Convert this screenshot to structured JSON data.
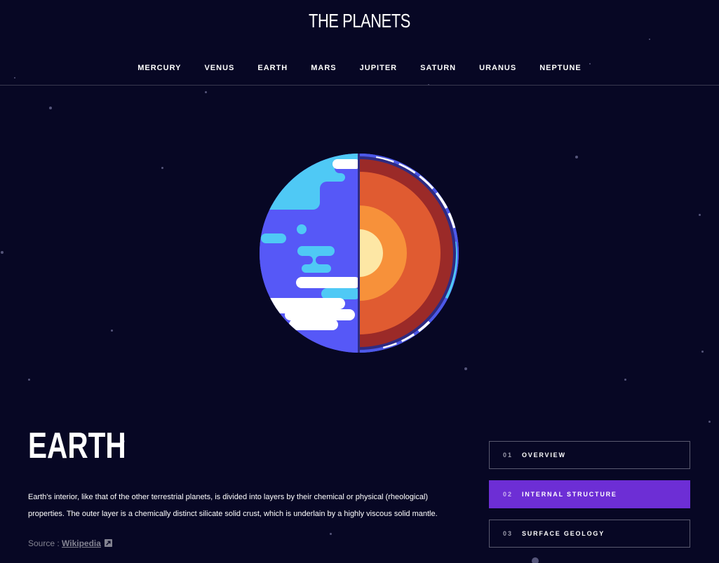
{
  "header": {
    "logo": "THE PLANETS"
  },
  "nav": {
    "items": [
      "MERCURY",
      "VENUS",
      "EARTH",
      "MARS",
      "JUPITER",
      "SATURN",
      "URANUS",
      "NEPTUNE"
    ]
  },
  "planet": {
    "name": "EARTH",
    "image_icon": "earth-internal-structure-illustration",
    "description": "Earth's interior, like that of the other terrestrial planets, is divided into layers by their chemical or physical (rheological) properties. The outer layer is a chemically distinct silicate solid crust, which is underlain by a highly viscous solid mantle.",
    "source_label": "Source : ",
    "source_link": "Wikipedia",
    "source_icon": "external-link-icon"
  },
  "tabs": [
    {
      "num": "01",
      "label": "OVERVIEW",
      "active": false
    },
    {
      "num": "02",
      "label": "INTERNAL STRUCTURE",
      "active": true
    },
    {
      "num": "03",
      "label": "SURFACE GEOLOGY",
      "active": false
    }
  ],
  "colors": {
    "background": "#070724",
    "accent": "#6d2ed5",
    "border": "#38384f"
  }
}
